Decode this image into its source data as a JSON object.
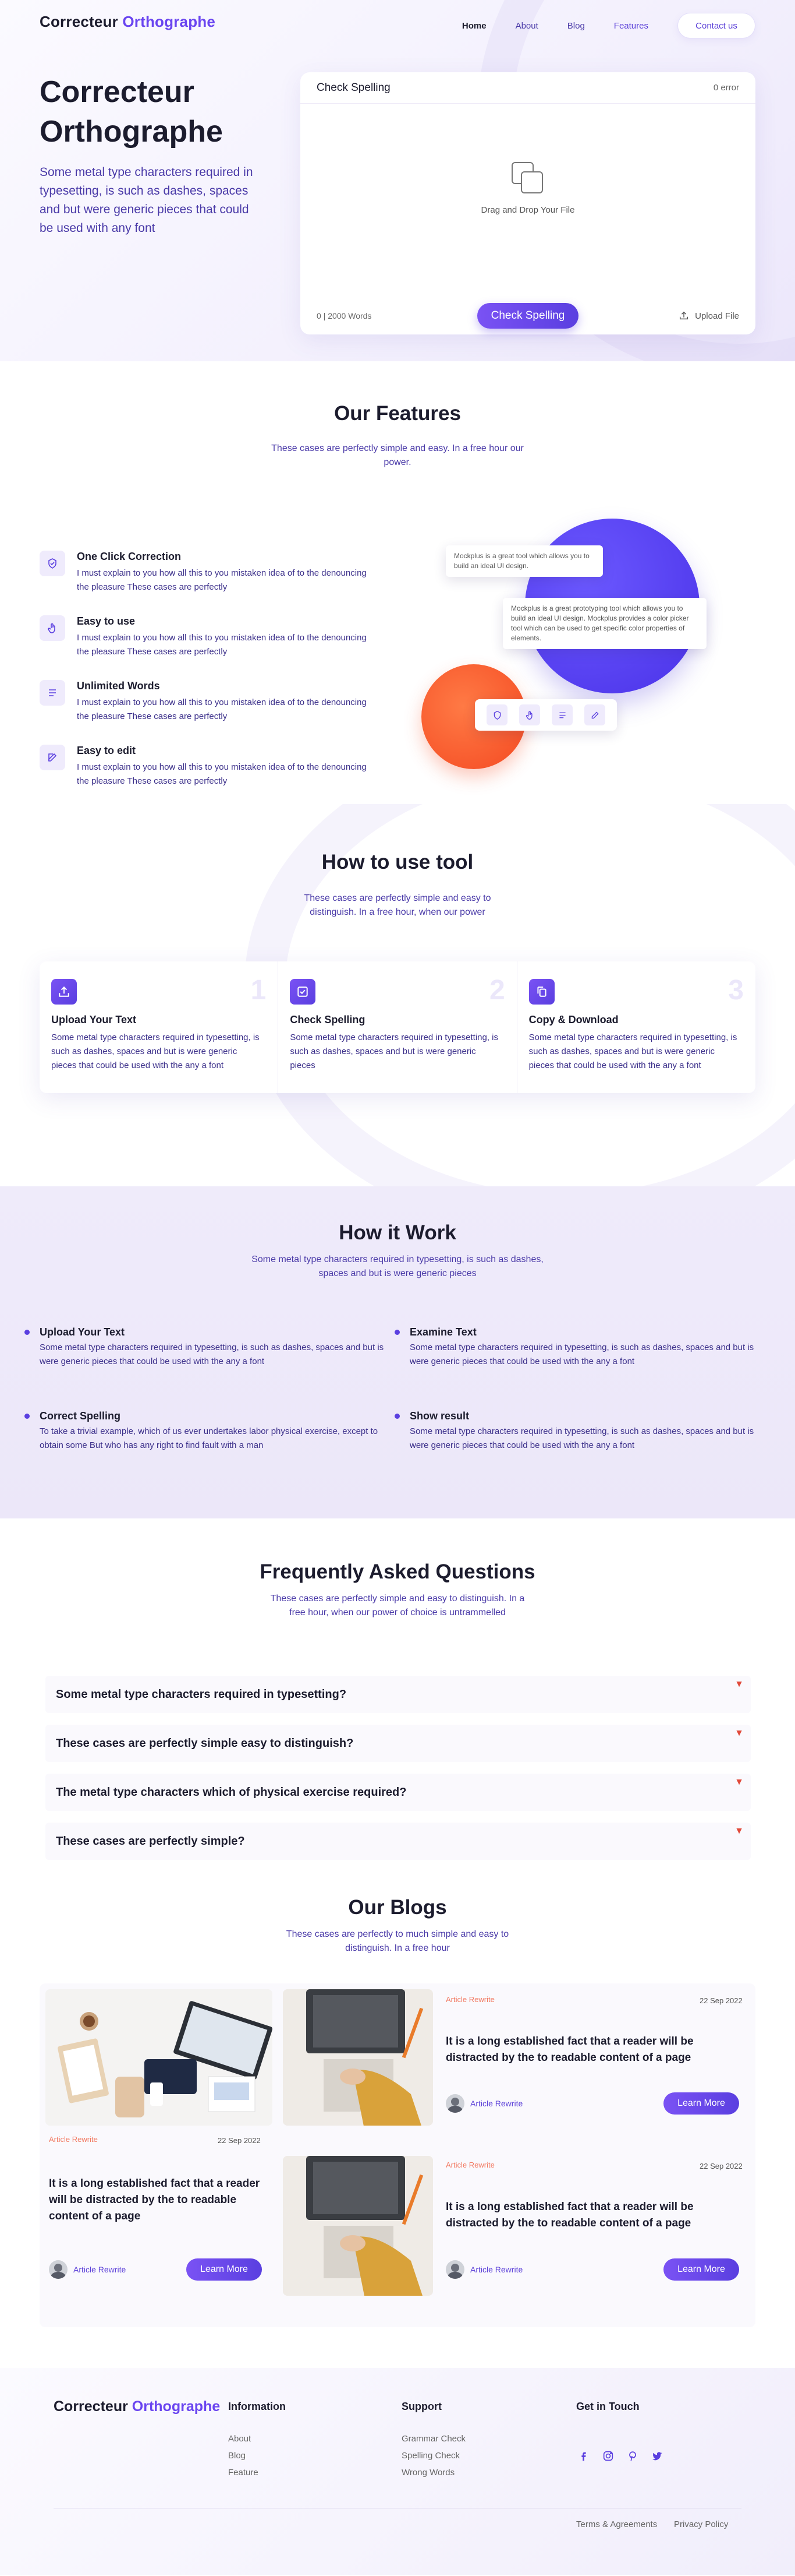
{
  "header": {
    "logo_primary": "Correcteur",
    "logo_accent": "Orthographe",
    "nav": [
      {
        "label": "Home"
      },
      {
        "label": "About"
      },
      {
        "label": "Blog"
      },
      {
        "label": "Features"
      }
    ],
    "contact_label": "Contact us"
  },
  "hero": {
    "title": "Correcteur Orthographe",
    "description": "Some metal type characters required in typesetting, is such as dashes, spaces and but were generic pieces that could be used with any font"
  },
  "checker": {
    "title": "Check Spelling",
    "error_count": "0 error",
    "drop_label": "Drag and Drop Your File",
    "word_count": "0 | 2000 Words",
    "check_label": "Check Spelling",
    "upload_label": "Upload File"
  },
  "features": {
    "title": "Our Features",
    "subtitle": "These cases are perfectly simple and easy. In a free hour our power.",
    "items": [
      {
        "name": "One Click Correction",
        "desc": "I must explain to you how all this to you mistaken idea of to the denouncing the pleasure These cases are perfectly",
        "icon": "shield-icon"
      },
      {
        "name": "Easy to use",
        "desc": "I must explain to you how all this to you mistaken idea of to the denouncing the pleasure These cases are perfectly",
        "icon": "hand-pointer-icon"
      },
      {
        "name": "Unlimited Words",
        "desc": "I must explain to you how all this to you mistaken idea of to the denouncing the pleasure These cases are perfectly",
        "icon": "list-icon"
      },
      {
        "name": "Easy to edit",
        "desc": "I must explain to you how all this to you mistaken idea of to the denouncing the pleasure These cases are perfectly",
        "icon": "edit-icon"
      }
    ],
    "tip1": "Mockplus is a great tool which allows you to build an ideal UI design.",
    "tip2": "Mockplus is a great prototyping tool which allows you to build an ideal UI design. Mockplus provides a color picker tool which can be used to get specific color properties of elements."
  },
  "howto": {
    "title": "How to use tool",
    "subtitle": "These cases are perfectly simple and easy to distinguish. In a free hour, when our power",
    "steps": [
      {
        "num": "1",
        "name": "Upload Your Text",
        "desc": "Some metal type characters required in typesetting, is such as dashes, spaces and but is were generic pieces that could be used with the any a font",
        "icon": "upload-icon"
      },
      {
        "num": "2",
        "name": "Check Spelling",
        "desc": "Some metal type characters required in typesetting, is such as dashes, spaces and but is were generic pieces",
        "icon": "check-icon"
      },
      {
        "num": "3",
        "name": "Copy & Download",
        "desc": "Some metal type characters required in typesetting, is such as dashes, spaces and but is were generic pieces that could be used with the any a font",
        "icon": "copy-icon"
      }
    ]
  },
  "how_it_work": {
    "title": "How it Work",
    "subtitle": "Some metal type characters required in typesetting, is such as dashes, spaces and but is were generic pieces",
    "items": [
      {
        "name": "Upload Your Text",
        "desc": "Some metal type characters required in typesetting, is such as dashes, spaces and but is were generic pieces that could be used with the any a font"
      },
      {
        "name": "Examine Text",
        "desc": "Some metal type characters required in typesetting, is such as dashes, spaces and but is were generic pieces that could be used with the any a font"
      },
      {
        "name": "Correct Spelling",
        "desc": "To take a trivial example, which of us ever undertakes labor physical exercise, except to obtain some But who has any right to find fault with a man"
      },
      {
        "name": "Show result",
        "desc": "Some metal type characters required in typesetting, is such as dashes, spaces and but is were generic pieces that could be used with the any a font"
      }
    ]
  },
  "faq": {
    "title": "Frequently Asked Questions",
    "subtitle": "These cases are perfectly simple and easy to distinguish. In a free hour, when our power of choice is untrammelled",
    "items": [
      {
        "q": "Some metal type characters required in typesetting?"
      },
      {
        "q": "These cases are perfectly simple easy to distinguish?"
      },
      {
        "q": "The metal type characters which of physical exercise required?"
      },
      {
        "q": "These cases are perfectly simple?"
      }
    ],
    "arrow": "▼"
  },
  "blogs": {
    "title": "Our Blogs",
    "subtitle": "These cases are perfectly to much simple and easy to distinguish. In a free hour",
    "posts": [
      {
        "tag": "Article Rewrite",
        "date": "22 Sep 2022",
        "title": "It is a long established fact that a reader will be distracted by the to readable content of a page",
        "author": "Article Rewrite",
        "cta": "Learn More"
      },
      {
        "tag": "Article Rewrite",
        "date": "22 Sep 2022",
        "title": "It is a long established fact that a reader will be distracted by the to readable content of a page",
        "author": "Article Rewrite",
        "cta": "Learn More"
      },
      {
        "tag": "Article Rewrite",
        "date": "22 Sep 2022",
        "title": "It is a long established fact that a reader will be distracted by the to readable content of a page",
        "author": "Article Rewrite",
        "cta": "Learn More"
      }
    ]
  },
  "footer": {
    "logo_primary": "Correcteur",
    "logo_accent": "Orthographe",
    "information": {
      "title": "Information",
      "links": [
        "About",
        "Blog",
        "Feature"
      ]
    },
    "support": {
      "title": "Support",
      "links": [
        "Grammar Check",
        "Spelling Check",
        "Wrong Words"
      ]
    },
    "touch": {
      "title": "Get in Touch"
    },
    "socials": [
      "facebook-icon",
      "instagram-icon",
      "pinterest-icon",
      "twitter-icon"
    ],
    "terms": "Terms & Agreements",
    "privacy": "Privacy Policy"
  },
  "colors": {
    "accent": "#6a45f0",
    "button_gradient_start": "#7a52f4",
    "button_gradient_end": "#5a3fe0",
    "orange": "#f44a22",
    "tag": "#f27a63"
  }
}
